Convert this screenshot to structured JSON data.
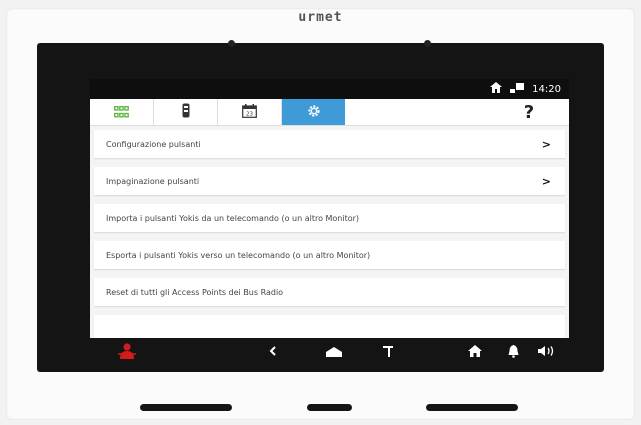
{
  "brand": "urmet",
  "status": {
    "time": "14:20",
    "home_icon": "home-icon",
    "network_icon": "network-icon"
  },
  "tabs": [
    {
      "icon": "grid-icon",
      "color": "#5bb33d"
    },
    {
      "icon": "remote-control-icon"
    },
    {
      "icon": "calendar-icon",
      "text": "23"
    },
    {
      "icon": "gear-icon",
      "active": true
    },
    {
      "label": "?"
    }
  ],
  "menu": [
    {
      "label": "Configurazione pulsanti",
      "chevron": ">"
    },
    {
      "label": "Impaginazione pulsanti",
      "chevron": ">"
    },
    {
      "label": "Importa i pulsanti Yokis da un telecomando (o un altro Monitor)"
    },
    {
      "label": "Esporta i pulsanti Yokis verso un telecomando (o un altro Monitor)"
    },
    {
      "label": "Reset di tutti gli Access Points dei Bus Radio"
    }
  ],
  "navbar": {
    "alarm_icon": "alarm-person-icon",
    "back_icon": "back-icon",
    "home_icon": "home-icon",
    "key_icon": "gate-key-icon",
    "house_icon": "house-icon",
    "bell_icon": "bell-icon",
    "volume_icon": "speaker-icon",
    "accent": "#d21c1c"
  },
  "colors": {
    "active_tab": "#3f9bd8",
    "bezel": "#141414"
  }
}
